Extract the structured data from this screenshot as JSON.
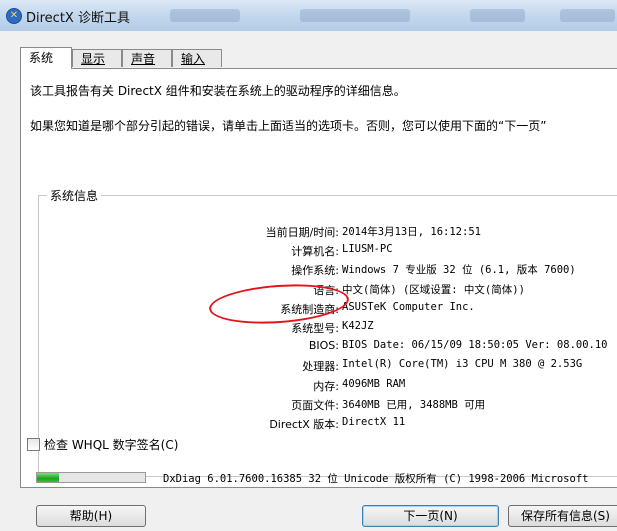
{
  "window": {
    "title": "DirectX 诊断工具",
    "icon": "directx-x-icon",
    "icon_glyph": "✕"
  },
  "tabs": [
    {
      "label": "系统",
      "active": true
    },
    {
      "label": "显示",
      "active": false
    },
    {
      "label": "声音",
      "active": false
    },
    {
      "label": "输入",
      "active": false
    }
  ],
  "intro": {
    "line1": "该工具报告有关 DirectX 组件和安装在系统上的驱动程序的详细信息。",
    "line2": "如果您知道是哪个部分引起的错误，请单击上面适当的选项卡。否则，您可以使用下面的“下一页”"
  },
  "system_info": {
    "group_title": "系统信息",
    "rows": [
      {
        "label": "当前日期/时间:",
        "value": "2014年3月13日, 16:12:51"
      },
      {
        "label": "计算机名:",
        "value": "LIUSM-PC"
      },
      {
        "label": "操作系统:",
        "value": "Windows 7 专业版 32 位 (6.1, 版本 7600)"
      },
      {
        "label": "语言:",
        "value": "中文(简体) (区域设置: 中文(简体))"
      },
      {
        "label": "系统制造商:",
        "value": "ASUSTeK Computer Inc."
      },
      {
        "label": "系统型号:",
        "value": "K42JZ"
      },
      {
        "label": "BIOS:",
        "value": "BIOS Date: 06/15/09 18:50:05 Ver: 08.00.10"
      },
      {
        "label": "处理器:",
        "value": "Intel(R) Core(TM) i3 CPU       M 380  @ 2.53G"
      },
      {
        "label": "内存:",
        "value": "4096MB RAM"
      },
      {
        "label": "页面文件:",
        "value": "3640MB 已用, 3488MB 可用"
      },
      {
        "label": "DirectX 版本:",
        "value": "DirectX 11"
      }
    ]
  },
  "whql": {
    "label": "检查 WHQL 数字签名(C)",
    "checked": false
  },
  "status": {
    "progress_fraction": 0.2,
    "text": "DxDiag 6.01.7600.16385 32 位 Unicode 版权所有 (C) 1998-2006 Microsoft"
  },
  "buttons": {
    "help": "帮助(H)",
    "next": "下一页(N)",
    "save": "保存所有信息(S)"
  },
  "colors": {
    "accent": "#3c7fb1",
    "annotation": "#e3151a",
    "progress": "#1ea31e"
  }
}
